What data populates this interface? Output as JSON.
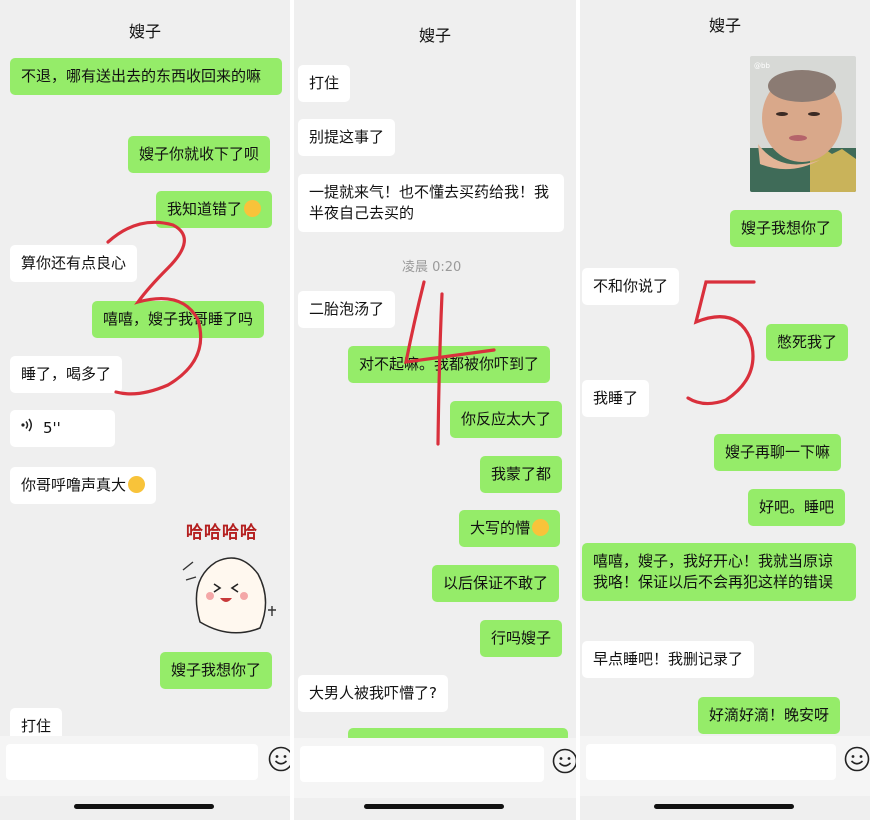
{
  "panel1": {
    "title": "嫂子",
    "messages": [
      {
        "from": "me",
        "text": "不退，哪有送出去的东西收回来的嘛"
      },
      {
        "from": "me",
        "text": "嫂子你就收下了呗"
      },
      {
        "from": "me",
        "text": "我知道错了"
      },
      {
        "from": "them",
        "text": "算你还有点良心"
      },
      {
        "from": "me",
        "text": "嘻嘻，嫂子我哥睡了吗"
      },
      {
        "from": "them",
        "text": "睡了，喝多了"
      },
      {
        "from": "them",
        "voice_duration": "5''"
      },
      {
        "from": "them",
        "text": "你哥呼噜声真大"
      },
      {
        "from": "me",
        "sticker_text": "哈哈哈哈"
      },
      {
        "from": "me",
        "text": "嫂子我想你了"
      },
      {
        "from": "them",
        "text": "打住"
      }
    ],
    "scribble": "3"
  },
  "panel2": {
    "title": "嫂子",
    "timestamp": "凌晨 0:20",
    "messages": [
      {
        "from": "them",
        "text": "打住"
      },
      {
        "from": "them",
        "text": "别提这事了"
      },
      {
        "from": "them",
        "text": "一提就来气！也不懂去买药给我！我半夜自己去买的"
      },
      {
        "from": "them",
        "text": "二胎泡汤了"
      },
      {
        "from": "me",
        "text": "对不起嘛。我都被你吓到了"
      },
      {
        "from": "me",
        "text": "你反应太大了"
      },
      {
        "from": "me",
        "text": "我蒙了都"
      },
      {
        "from": "me",
        "text": "大写的懵"
      },
      {
        "from": "me",
        "text": "以后保证不敢了"
      },
      {
        "from": "me",
        "text": "行吗嫂子"
      },
      {
        "from": "them",
        "text": "大男人被我吓懵了?"
      }
    ],
    "scribble": "4"
  },
  "panel3": {
    "title": "嫂子",
    "messages": [
      {
        "from": "me",
        "image": "photo"
      },
      {
        "from": "me",
        "text": "嫂子我想你了"
      },
      {
        "from": "them",
        "text": "不和你说了"
      },
      {
        "from": "me",
        "text": "憋死我了"
      },
      {
        "from": "them",
        "text": "我睡了"
      },
      {
        "from": "me",
        "text": "嫂子再聊一下嘛"
      },
      {
        "from": "me",
        "text": "好吧。睡吧"
      },
      {
        "from": "me",
        "text": "嘻嘻，嫂子，我好开心！我就当原谅我咯！保证以后不会再犯这样的错误"
      },
      {
        "from": "them",
        "text": "早点睡吧！我删记录了"
      },
      {
        "from": "me",
        "text": "好滴好滴！晚安呀"
      }
    ],
    "scribble": "5"
  },
  "colors": {
    "my_bubble": "#95ec69",
    "their_bubble": "#ffffff",
    "background": "#efefef",
    "scribble": "#d9303c"
  },
  "icons": {
    "emoji_button": "smiley-icon",
    "voice": "voice-wave-icon"
  }
}
